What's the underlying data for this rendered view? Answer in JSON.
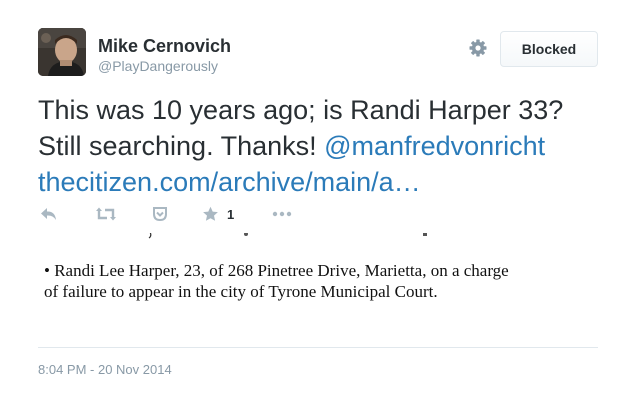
{
  "user": {
    "display_name": "Mike Cernovich",
    "screen_name": "@PlayDangerously"
  },
  "header": {
    "settings_icon": "gear-icon",
    "blocked_label": "Blocked"
  },
  "tweet": {
    "text_part1": "This was 10 years ago; is Randi Harper 33?",
    "text_part2": "Still searching. Thanks! ",
    "mention": "@manfredvonricht",
    "link": "thecitizen.com/archive/main/a…"
  },
  "actions": {
    "reply_icon": "reply-icon",
    "retweet_icon": "retweet-icon",
    "pocket_icon": "pocket-icon",
    "favorite_icon": "star-icon",
    "favorite_count": "1",
    "more_icon": "more-icon"
  },
  "media": {
    "clipping_line1": "• Randi Lee Harper, 23, of 268 Pinetree Drive, Marietta, on a charge",
    "clipping_line2": "of failure to appear in the city of Tyrone Municipal Court."
  },
  "footer": {
    "timestamp": "8:04 PM - 20 Nov 2014"
  },
  "colors": {
    "link": "#2b7bb9",
    "muted": "#8899a6",
    "text": "#292f33",
    "border": "#e1e8ed"
  }
}
